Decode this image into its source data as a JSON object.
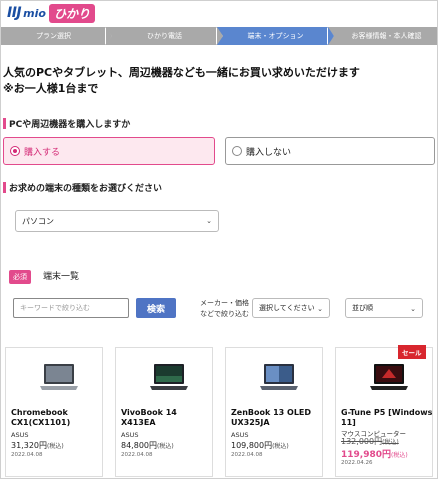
{
  "logo": {
    "iij": "IIJ",
    "mio": "mio",
    "hikari": "ひかり"
  },
  "steps": [
    {
      "label": "プラン選択",
      "active": false
    },
    {
      "label": "ひかり電話",
      "active": false
    },
    {
      "label": "端末・オプション",
      "active": true
    },
    {
      "label": "お客様情報・本人確認",
      "active": false
    }
  ],
  "intro": {
    "line1": "人気のPCやタブレット、周辺機器なども一緒にお買い求めいただけます",
    "line2": "※お一人様1台まで"
  },
  "purchase_question": {
    "label": "PCや周辺機器を購入しますか",
    "options": [
      {
        "label": "購入する",
        "selected": true
      },
      {
        "label": "購入しない",
        "selected": false
      }
    ]
  },
  "device_type": {
    "label": "お求めの端末の種類をお選びください",
    "selected": "パソコン"
  },
  "device_list": {
    "required_badge": "必須",
    "title": "端末一覧",
    "keyword_placeholder": "キーワードで絞り込む",
    "search_label": "検索",
    "filter_label_line1": "メーカー・価格",
    "filter_label_line2": "などで絞り込む",
    "filter_select": "選択してください",
    "sort_select": "並び順"
  },
  "products": [
    {
      "name": "Chromebook CX1(CX1101)",
      "maker": "ASUS",
      "price": "31,320円",
      "tax": "(税込)",
      "date": "2022.04.08"
    },
    {
      "name": "VivoBook 14 X413EA",
      "maker": "ASUS",
      "price": "84,800円",
      "tax": "(税込)",
      "date": "2022.04.08"
    },
    {
      "name": "ZenBook 13 OLED UX325JA",
      "maker": "ASUS",
      "price": "109,800円",
      "tax": "(税込)",
      "date": "2022.04.08"
    },
    {
      "name": "G-Tune P5 [Windows 11]",
      "maker": "マウスコンピューター",
      "old_price": "132,000円",
      "old_tax": "(税込)",
      "price": "119,980円",
      "tax": "(税込)",
      "date": "2022.04.26",
      "sale": "セール"
    }
  ],
  "colors": {
    "brand_pink": "#e24a8c",
    "brand_blue": "#1b4fa3",
    "active_step": "#5a86cf",
    "button_blue": "#4f74c4",
    "sale_red": "#d8262e"
  }
}
